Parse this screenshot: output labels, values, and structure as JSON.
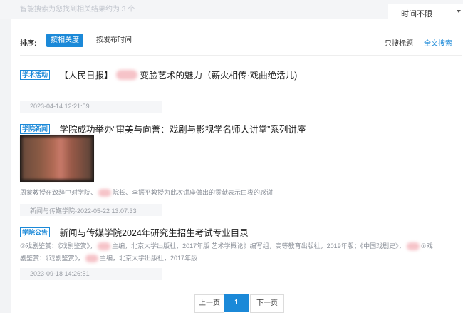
{
  "header": {
    "result_count": "智能搜索为您找到相关结果约为 3 个",
    "time_filter": "时间不限"
  },
  "sort": {
    "label": "排序:",
    "by_relevance": "按相关度",
    "by_date": "按发布时间",
    "title_only": "只搜标题",
    "full_text": "全文搜索"
  },
  "results": [
    {
      "tag": "学术活动",
      "title_pre": "【人民日报】",
      "title_post": "变脸艺术的魅力（薪火相传·戏曲绝活儿)",
      "meta": "2023-04-14 12:21:59"
    },
    {
      "tag": "学院新闻",
      "title": "学院成功举办“审美与向善：戏剧与影视学名师大讲堂”系列讲座",
      "snippet_pre": "周蒙教授在致辞中对学院、",
      "snippet_post": "院长、李振平教授为此次讲座做出的贡献表示由衷的感谢",
      "meta": "新闻与传媒学院-2022-05-22 13:07:33"
    },
    {
      "tag": "学院公告",
      "title": "新闻与传媒学院2024年研究生招生考试专业目录",
      "snippet_line1_a": "②戏剧鉴赏：《戏剧鉴赏》，",
      "snippet_line1_b": "主编，北京大学出版社，2017年版 艺术学概论》编写组，高等教育出版社，2019年版；《中国戏剧史》，",
      "snippet_line1_c": "①戏",
      "snippet_line2_a": "剧鉴赏：《戏剧鉴赏》，",
      "snippet_line2_b": "主编，北京大学出版社，2017年版",
      "meta": "2023-09-18 14:26:51"
    }
  ],
  "pagination": {
    "prev": "上一页",
    "current": "1",
    "next": "下一页"
  }
}
